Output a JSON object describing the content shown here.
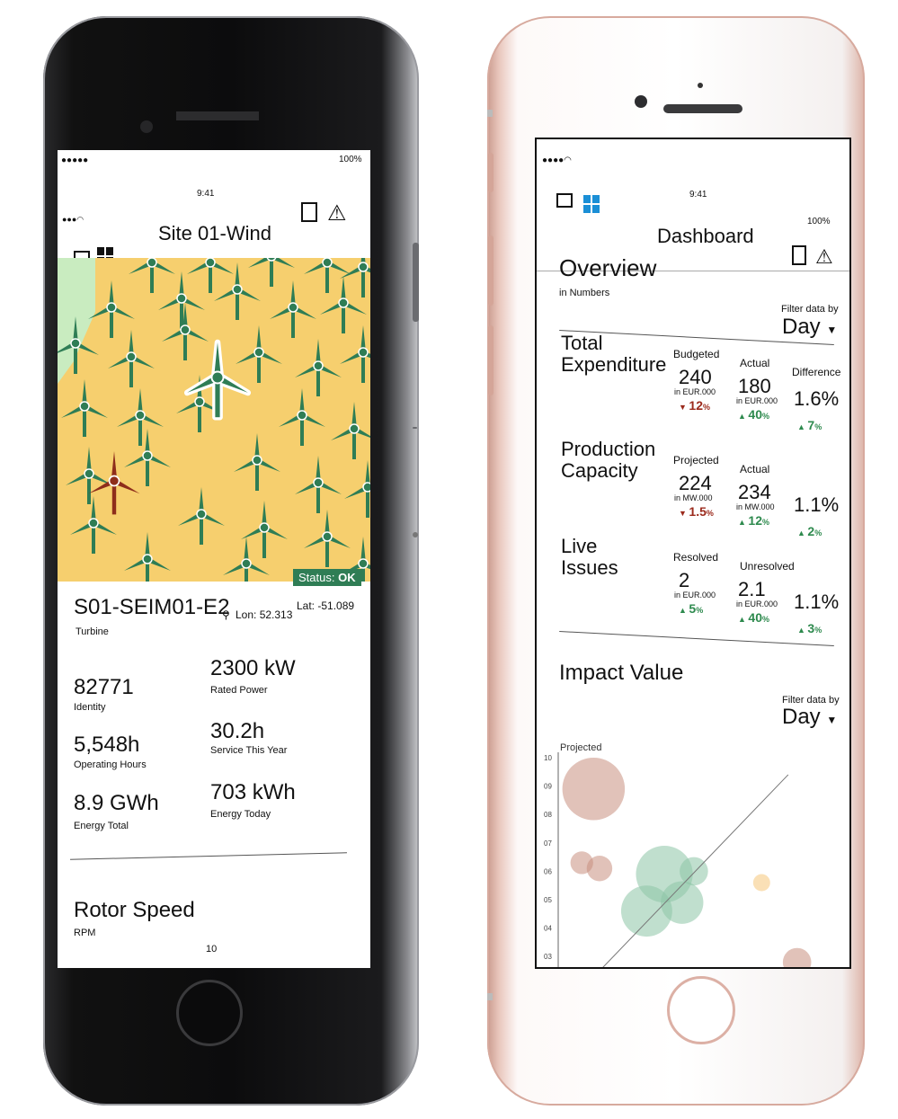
{
  "left_phone": {
    "status_bar": {
      "time": "9:41",
      "battery": "100%"
    },
    "header": {
      "title": "Site 01-Wind"
    },
    "map": {
      "background_color": "#f6cf6e",
      "turbine_color": "#2f7d55",
      "alert_turbine_color": "#8e2d1b",
      "selected_turbine_color": "#2f7d55",
      "park_color": "#c9ecc0"
    },
    "turbine": {
      "status_label": "Status:",
      "status_value": "OK",
      "id": "S01-SEIM01-E2",
      "type_label": "Turbine",
      "lon": "Lon: 52.313",
      "lat": "Lat: -51.089"
    },
    "metrics": [
      {
        "value": "82771",
        "label": "Identity"
      },
      {
        "value": "2300 kW",
        "label": "Rated Power"
      },
      {
        "value": "5,548h",
        "label": "Operating Hours"
      },
      {
        "value": "30.2h",
        "label": "Service This Year"
      },
      {
        "value": "8.9 GWh",
        "label": "Energy Total"
      },
      {
        "value": "703 kWh",
        "label": "Energy Today"
      }
    ],
    "rotor": {
      "title": "Rotor Speed",
      "unit": "RPM",
      "axis_top": "10"
    }
  },
  "right_phone": {
    "status_bar": {
      "time": "9:41",
      "battery": "100%"
    },
    "header": {
      "title": "Dashboard"
    },
    "overview": {
      "title": "Overview",
      "subtitle": "in Numbers",
      "filter_label": "Filter data by",
      "filter_value": "Day"
    },
    "rows": [
      {
        "title1": "Total",
        "title2": "Expenditure",
        "c1_label": "Budgeted",
        "c1_value": "240",
        "c1_unit": "in EUR.000",
        "c1_delta": "12",
        "c1_dir": "down",
        "c2_label": "Actual",
        "c2_value": "180",
        "c2_unit": "in EUR.000",
        "c2_delta": "40",
        "c2_dir": "up",
        "c3_label": "Difference",
        "c3_value": "1.6%",
        "c3_delta": "7",
        "c3_dir": "up"
      },
      {
        "title1": "Production",
        "title2": "Capacity",
        "c1_label": "Projected",
        "c1_value": "224",
        "c1_unit": "in MW.000",
        "c1_delta": "1.5",
        "c1_dir": "down",
        "c2_label": "Actual",
        "c2_value": "234",
        "c2_unit": "in MW.000",
        "c2_delta": "12",
        "c2_dir": "up",
        "c3_label": "",
        "c3_value": "1.1%",
        "c3_delta": "2",
        "c3_dir": "up"
      },
      {
        "title1": "Live",
        "title2": "Issues",
        "c1_label": "Resolved",
        "c1_value": "2",
        "c1_unit": "in EUR.000",
        "c1_delta": "5",
        "c1_dir": "up",
        "c2_label": "Unresolved",
        "c2_value": "2.1",
        "c2_unit": "in EUR.000",
        "c2_delta": "40",
        "c2_dir": "up",
        "c3_label": "",
        "c3_value": "1.1%",
        "c3_delta": "3",
        "c3_dir": "up"
      }
    ],
    "percent_sign": "%",
    "impact": {
      "title": "Impact Value",
      "filter_label": "Filter data by",
      "filter_value": "Day"
    }
  },
  "chart_data": {
    "type": "scatter",
    "title": "",
    "ylabel": "Projected",
    "y_ticks": [
      "10",
      "09",
      "08",
      "07",
      "06",
      "05",
      "04",
      "03"
    ],
    "ylim": [
      2.5,
      10
    ],
    "xlim": [
      0,
      10
    ],
    "series": [
      {
        "color": "#c98f80",
        "points": [
          {
            "x": 1.2,
            "y": 8.9,
            "r": 1.1
          },
          {
            "x": 0.8,
            "y": 6.3,
            "r": 0.4
          },
          {
            "x": 1.4,
            "y": 6.1,
            "r": 0.45
          }
        ]
      },
      {
        "color": "#8cc4a6",
        "points": [
          {
            "x": 3.6,
            "y": 5.9,
            "r": 1.0
          },
          {
            "x": 4.6,
            "y": 6.0,
            "r": 0.5
          },
          {
            "x": 3.0,
            "y": 4.6,
            "r": 0.9
          },
          {
            "x": 4.2,
            "y": 4.9,
            "r": 0.75
          }
        ]
      },
      {
        "color": "#f5c77a",
        "points": [
          {
            "x": 6.9,
            "y": 5.6,
            "r": 0.3
          }
        ]
      },
      {
        "color": "#c98f80",
        "points": [
          {
            "x": 8.1,
            "y": 2.8,
            "r": 0.5
          }
        ]
      }
    ],
    "trendline": [
      [
        1.5,
        2.6
      ],
      [
        7.8,
        9.4
      ]
    ]
  }
}
